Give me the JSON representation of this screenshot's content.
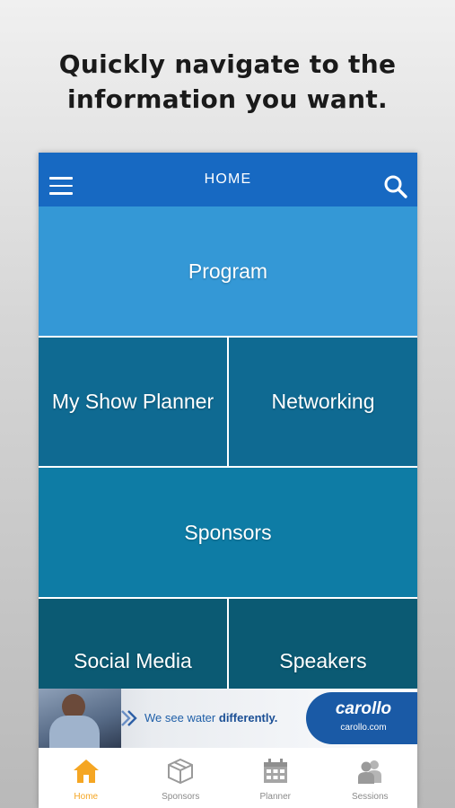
{
  "headline": {
    "line1": "Quickly navigate to the",
    "line2": "information you want."
  },
  "topbar": {
    "title": "HOME",
    "menu_icon": "hamburger-menu-icon",
    "search_icon": "search-icon"
  },
  "tiles": [
    {
      "label": "Program"
    },
    {
      "label": "My Show Planner"
    },
    {
      "label": "Networking"
    },
    {
      "label": "Sponsors"
    },
    {
      "label": "Social Media"
    },
    {
      "label": "Speakers"
    }
  ],
  "ad": {
    "tagline_prefix": "We see water",
    "tagline_emphasis": "differently.",
    "brand": "carollo",
    "url": "carollo.com"
  },
  "tabbar": {
    "items": [
      {
        "label": "Home",
        "icon": "home-icon",
        "active": true
      },
      {
        "label": "Sponsors",
        "icon": "box-icon",
        "active": false
      },
      {
        "label": "Planner",
        "icon": "calendar-icon",
        "active": false
      },
      {
        "label": "Sessions",
        "icon": "people-icon",
        "active": false
      }
    ]
  },
  "colors": {
    "topbar": "#1769c2",
    "program_tile": "#3498d6",
    "dark_tile": "#0f6a92",
    "sponsors_tile": "#0e7ca5",
    "social_tile": "#0b5a73",
    "active_tab": "#f5a623",
    "inactive_tab": "#8a8a8a"
  }
}
